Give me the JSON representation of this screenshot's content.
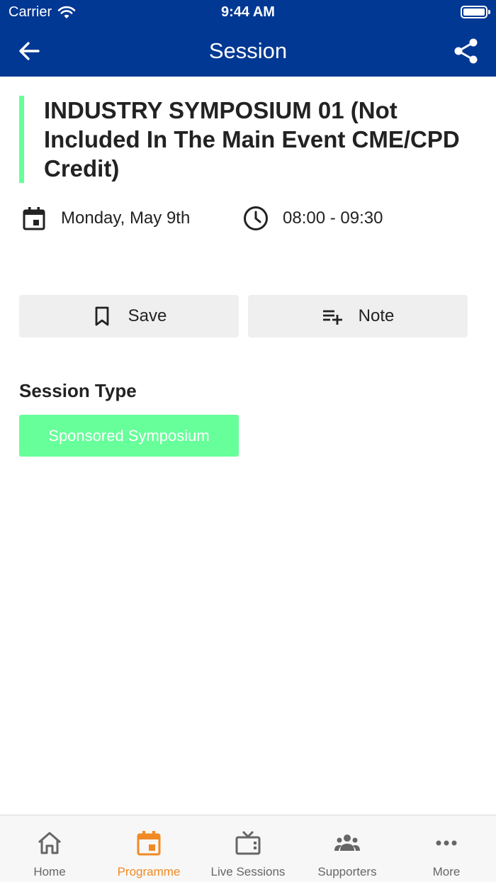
{
  "status_bar": {
    "carrier": "Carrier",
    "time": "9:44 AM"
  },
  "nav": {
    "title": "Session"
  },
  "session": {
    "title": "INDUSTRY SYMPOSIUM 01 (Not Included In The Main Event CME/CPD Credit)",
    "date": "Monday, May 9th",
    "time": "08:00 - 09:30",
    "accent_color": "#66ff99"
  },
  "actions": {
    "save_label": "Save",
    "note_label": "Note"
  },
  "session_type": {
    "heading": "Session Type",
    "value": "Sponsored Symposium"
  },
  "tabs": [
    {
      "label": "Home",
      "icon": "home-icon"
    },
    {
      "label": "Programme",
      "icon": "calendar-icon",
      "active": true
    },
    {
      "label": "Live Sessions",
      "icon": "tv-icon"
    },
    {
      "label": "Supporters",
      "icon": "people-icon"
    },
    {
      "label": "More",
      "icon": "more-icon"
    }
  ],
  "colors": {
    "header": "#003893",
    "active_tab": "#f08a24",
    "inactive_tab": "#666666"
  }
}
